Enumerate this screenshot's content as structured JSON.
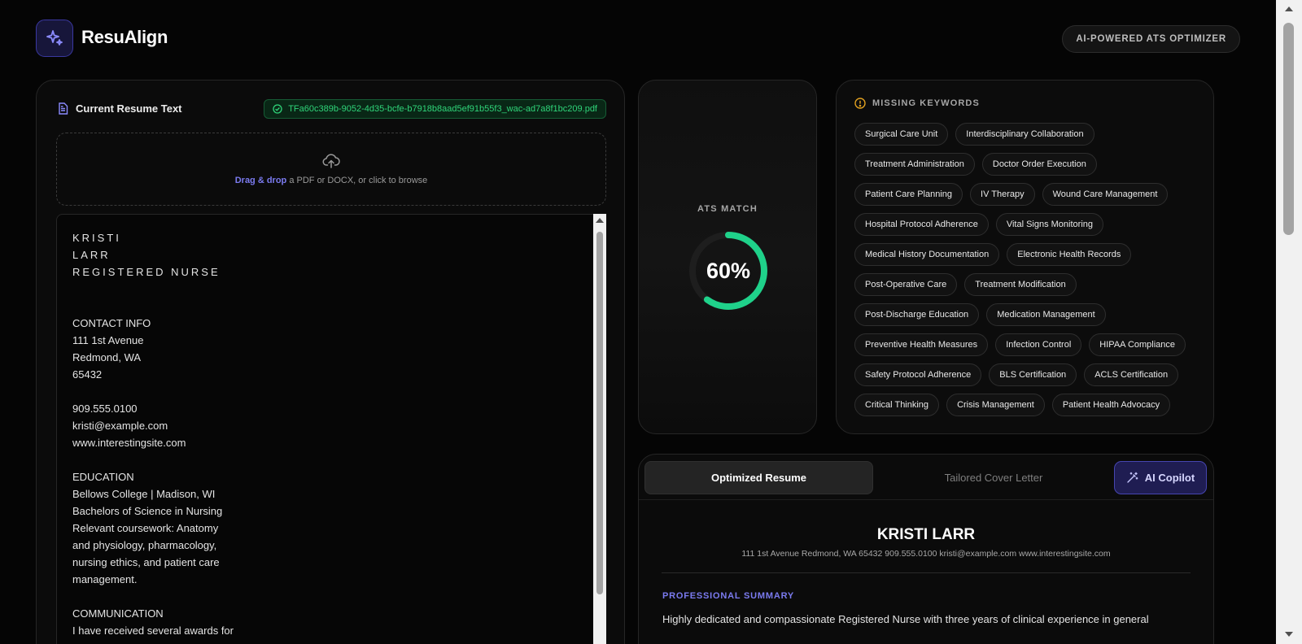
{
  "app": {
    "brand": "ResuAlign",
    "tagline": "AI-POWERED ATS OPTIMIZER"
  },
  "resume_input": {
    "title": "Current Resume Text",
    "file_name": "TFa60c389b-9052-4d35-bcfe-b7918b8aad5ef91b55f3_wac-ad7a8f1bc209.pdf",
    "dropzone_highlight": "Drag & drop",
    "dropzone_text": " a PDF or DOCX, or click to browse",
    "lines": [
      "KRISTI",
      "LARR",
      "REGISTERED NURSE",
      "",
      "",
      "CONTACT INFO",
      "111 1st Avenue",
      "Redmond, WA",
      "65432",
      "",
      "909.555.0100",
      "kristi@example.com",
      "www.interestingsite.com",
      "",
      "EDUCATION",
      "Bellows College | Madison, WI",
      "Bachelors of Science in Nursing",
      "Relevant coursework: Anatomy",
      "and physiology, pharmacology,",
      "nursing ethics, and patient care",
      "management.",
      "",
      "COMMUNICATION",
      "I have received several awards for"
    ]
  },
  "ats": {
    "label": "ATS MATCH",
    "value_text": "60%",
    "value": 60,
    "ring_color": "#1fd18a"
  },
  "keywords": {
    "title": "MISSING KEYWORDS",
    "items": [
      "Surgical Care Unit",
      "Interdisciplinary Collaboration",
      "Treatment Administration",
      "Doctor Order Execution",
      "Patient Care Planning",
      "IV Therapy",
      "Wound Care Management",
      "Hospital Protocol Adherence",
      "Vital Signs Monitoring",
      "Medical History Documentation",
      "Electronic Health Records",
      "Post-Operative Care",
      "Treatment Modification",
      "Post-Discharge Education",
      "Medication Management",
      "Preventive Health Measures",
      "Infection Control",
      "HIPAA Compliance",
      "Safety Protocol Adherence",
      "BLS Certification",
      "ACLS Certification",
      "Critical Thinking",
      "Crisis Management",
      "Patient Health Advocacy"
    ]
  },
  "output": {
    "tabs": [
      {
        "label": "Optimized Resume",
        "active": true
      },
      {
        "label": "Tailored Cover Letter",
        "active": false
      }
    ],
    "copilot_label": "AI Copilot",
    "doc": {
      "name": "KRISTI LARR",
      "contact": "111 1st Avenue Redmond, WA 65432 909.555.0100 kristi@example.com www.interestingsite.com",
      "section": "PROFESSIONAL SUMMARY",
      "summary": "Highly dedicated and compassionate Registered Nurse with three years of clinical experience in general"
    }
  },
  "colors": {
    "accent": "#7b7bf0",
    "success": "#2fd479",
    "warning": "#e0a020"
  }
}
